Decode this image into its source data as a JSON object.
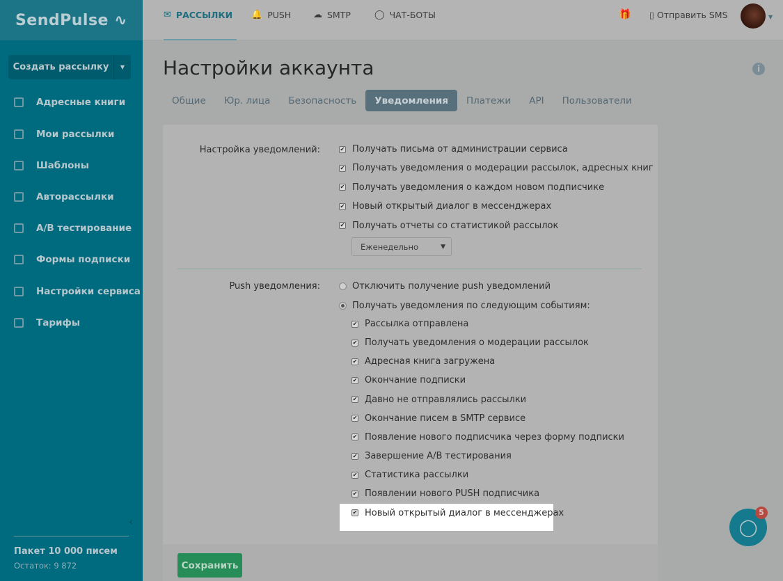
{
  "logo": "SendPulse",
  "sidebar": {
    "create_label": "Создать рассылку",
    "items": [
      {
        "label": "Адресные книги",
        "icon": "address-book-icon"
      },
      {
        "label": "Мои рассылки",
        "icon": "mailings-icon"
      },
      {
        "label": "Шаблоны",
        "icon": "templates-icon"
      },
      {
        "label": "Авторассылки",
        "icon": "automation-icon"
      },
      {
        "label": "A/B тестирование",
        "icon": "ab-test-icon"
      },
      {
        "label": "Формы подписки",
        "icon": "forms-icon"
      },
      {
        "label": "Настройки сервиса",
        "icon": "settings-icon"
      },
      {
        "label": "Тарифы",
        "icon": "pricing-icon"
      }
    ],
    "package": "Пакет 10 000 писем",
    "remaining": "Остаток: 9 872"
  },
  "topnav": {
    "items": [
      {
        "label": "РАССЫЛКИ",
        "icon": "✉"
      },
      {
        "label": "PUSH",
        "icon": "🔔"
      },
      {
        "label": "SMTP",
        "icon": "☁"
      },
      {
        "label": "ЧАТ-БОТЫ",
        "icon": "◯"
      }
    ],
    "sms": "Отправить SMS"
  },
  "page": {
    "title": "Настройки аккаунта",
    "tabs": [
      "Общие",
      "Юр. лица",
      "Безопасность",
      "Уведомления",
      "Платежи",
      "API",
      "Пользователи"
    ],
    "active_tab": "Уведомления"
  },
  "notif": {
    "label": "Настройка уведомлений:",
    "items": [
      "Получать письма от администрации сервиса",
      "Получать уведомления о модерации рассылок, адресных книг",
      "Получать уведомления о каждом новом подписчике",
      "Новый открытый диалог в мессенджерах",
      "Получать отчеты со статистикой рассылок"
    ],
    "frequency": "Еженедельно"
  },
  "push": {
    "label": "Push уведомления:",
    "radios": [
      "Отключить получение push уведомлений",
      "Получать уведомления по следующим событиям:"
    ],
    "selected_radio": 1,
    "items": [
      "Рассылка отправлена",
      "Получать уведомления о модерации рассылок",
      "Адресная книга загружена",
      "Окончание подписки",
      "Давно не отправлялись рассылки",
      "Окончание писем в SMTP сервисе",
      "Появление нового подписчика через форму подписки",
      "Завершение A/B тестирования",
      "Статистика рассылки",
      "Появлении нового PUSH подписчика",
      "Новый открытый диалог в мессенджерах"
    ]
  },
  "save_label": "Сохранить",
  "chat_badge": "5"
}
